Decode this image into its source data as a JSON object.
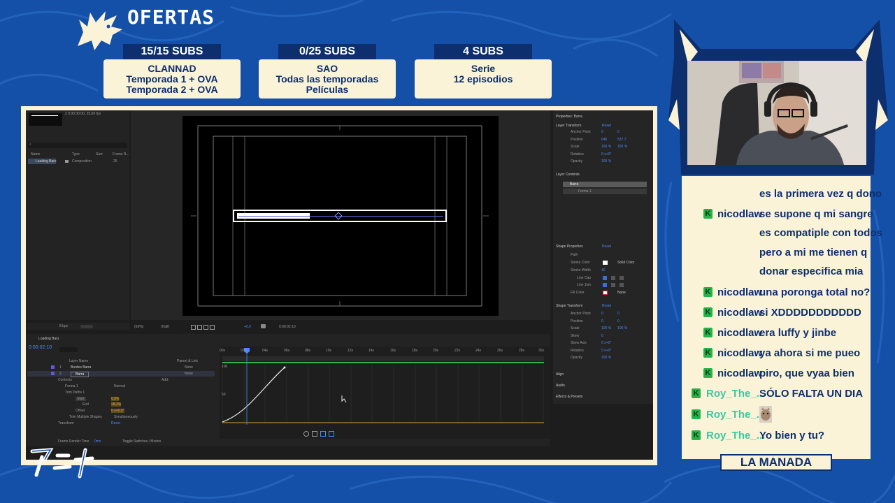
{
  "offers": {
    "title": "OFERTAS",
    "items": [
      {
        "subs": "15/15 SUBS",
        "line1": "CLANNAD",
        "line2": "Temporada 1 + OVA",
        "line3": "Temporada 2 + OVA"
      },
      {
        "subs": "0/25 SUBS",
        "line1": "SAO",
        "line2": "Todas las temporadas",
        "line3": "Películas"
      },
      {
        "subs": "4 SUBS",
        "line1": "Serie",
        "line2": "12 episodios",
        "line3": ""
      }
    ]
  },
  "ae": {
    "project": {
      "info": "2 0:00:30:00, 25,00 fps",
      "search_placeholder": "",
      "col_name": "Name",
      "col_type": "Type",
      "col_size": "Size",
      "col_frame": "Frame R...",
      "item_name": "Loading Bars",
      "item_type": "Composition",
      "item_rate": "25",
      "bpc": "8 bpc"
    },
    "viewer": {
      "zoom": "(50%)",
      "quality": "(Half)",
      "exposure": "+0,0",
      "timecode": "0:00:02:10"
    },
    "properties": {
      "title": "Properties: Barra",
      "layer_transform": "Layer Transform",
      "reset": "Reset",
      "anchor_point": "Anchor Point",
      "anchor_vals": [
        "0",
        "0"
      ],
      "position": "Position",
      "position_vals": [
        "645",
        "537,7"
      ],
      "scale": "Scale",
      "scale_vals": [
        "100 %",
        "100 %"
      ],
      "rotation": "Rotation",
      "rotation_val": "0 x+0°",
      "opacity": "Opacity",
      "opacity_val": "100 %",
      "layer_contents": "Layer Contents",
      "contents_items": [
        "Barra",
        "Forma 1"
      ],
      "shape_properties": "Shape Properties",
      "path": "Path",
      "stroke_color": "Stroke Color",
      "solid_color": "Solid Color",
      "stroke_width": "Stroke Width",
      "stroke_width_val": "40",
      "line_cap": "Line Cap",
      "line_join": "Line Join",
      "fill_color": "Fill Color",
      "fill_none": "None",
      "shape_transform": "Shape Transform",
      "st_anchor": "Anchor Point",
      "st_anchor_vals": [
        "0",
        "0"
      ],
      "st_position": "Position",
      "st_position_vals": [
        "0",
        "0"
      ],
      "st_scale": "Scale",
      "st_scale_vals": [
        "100 %",
        "100 %"
      ],
      "st_skew": "Skew",
      "st_skew_val": "0",
      "st_skew_axis": "Skew Axis",
      "st_skew_axis_val": "0 x+0°",
      "st_rotation": "Rotation",
      "st_rotation_val": "0 x+0°",
      "st_opacity": "Opacity",
      "st_opacity_val": "100 %",
      "align": "Align",
      "audio": "Audio",
      "effects": "Effects & Presets"
    },
    "timeline": {
      "tab": "Loading Bars",
      "timecode": "0:00:02:10",
      "col_layer_name": "Layer Name",
      "col_parent": "Parent & Link",
      "layers": [
        {
          "num": "1",
          "name": "Bordes Barra",
          "parent": "None"
        },
        {
          "num": "2",
          "name": "Barra",
          "parent": "None"
        }
      ],
      "contents": "Contents",
      "add": "Add:",
      "forma": "Forma 1",
      "normal": "Normal",
      "trim": "Trim Paths 1",
      "start": "Start",
      "start_val": "0,0%",
      "end": "End",
      "end_val": "28,2%",
      "offset": "Offset",
      "offset_val": "0 x+0,0°",
      "trim_multiple": "Trim Multiple Shapes",
      "simultaneously": "Simultaneously",
      "transform": "Transform",
      "reset": "Reset",
      "ruler": [
        "00s",
        "02s",
        "04s",
        "06s",
        "08s",
        "10s",
        "12s",
        "14s",
        "16s",
        "18s",
        "20s",
        "22s",
        "24s",
        "26s",
        "28s",
        "30s"
      ],
      "graph_100": "100",
      "graph_50": "50",
      "frame_render": "Frame Render Time",
      "frame_render_val": "0ms",
      "toggle": "Toggle Switches / Modes"
    }
  },
  "chat": {
    "messages": [
      {
        "user": "",
        "text": "es la primera vez q dono",
        "badge": false
      },
      {
        "user": "nicodlaw",
        "text": "se supone q mi sangre",
        "badge": true
      },
      {
        "user": "",
        "text": "es compatiple con todos",
        "badge": false
      },
      {
        "user": "",
        "text": "pero a mi me tienen q",
        "badge": false
      },
      {
        "user": "",
        "text": "donar especifica mia",
        "badge": false
      },
      {
        "user": "nicodlaw",
        "text": "una poronga total no?",
        "badge": true
      },
      {
        "user": "nicodlaw",
        "text": "si XDDDDDDDDDDD",
        "badge": true
      },
      {
        "user": "nicodlaw",
        "text": "era luffy y jinbe",
        "badge": true
      },
      {
        "user": "nicodlaw",
        "text": "ya ahora si me pueo",
        "badge": true
      },
      {
        "user": "nicodlaw",
        "text": "piro, que vyaa bien",
        "badge": true
      },
      {
        "user": "Roy_The_...",
        "text": "SÓLO FALTA UN DIA",
        "badge": true
      },
      {
        "user": "Roy_The_...",
        "text": "",
        "badge": true
      },
      {
        "user": "Roy_The_...",
        "text": "Yo bien y tu?",
        "badge": true
      }
    ],
    "badge_letter": "K",
    "footer": "LA MANADA"
  },
  "colors": {
    "brand_blue": "#1550a8",
    "navy": "#0d2f6e",
    "cream": "#fbf3d8",
    "badge_green": "#27b24a",
    "ae_blue": "#4a8cff"
  }
}
